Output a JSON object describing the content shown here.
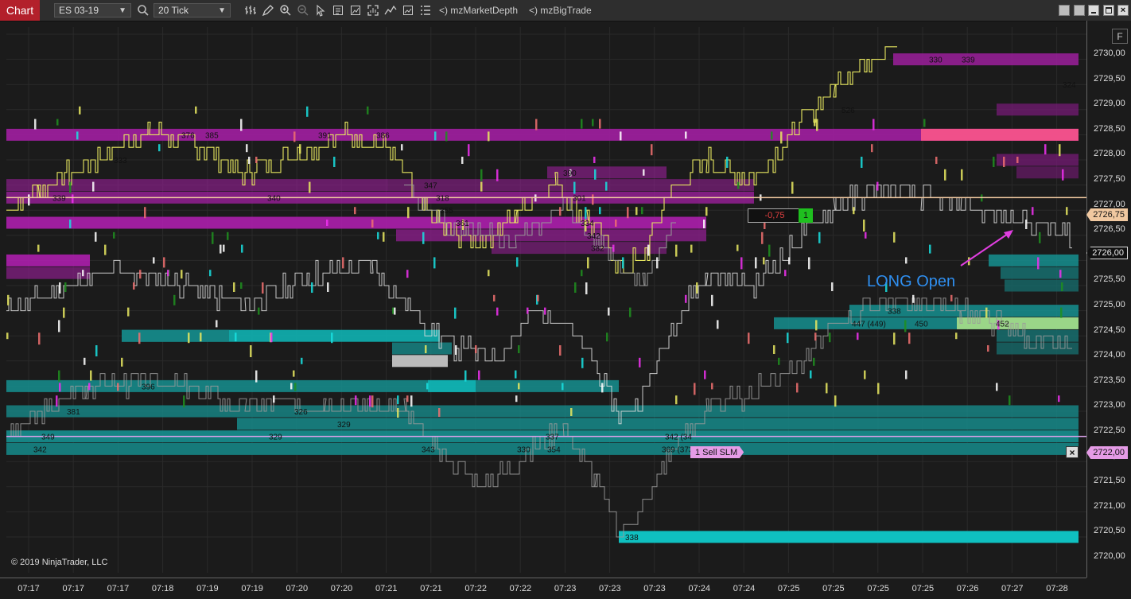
{
  "toolbar": {
    "tab_label": "Chart",
    "instrument": "ES 03-19",
    "bar_type": "20 Tick",
    "indicator1": "<)  mzMarketDepth",
    "indicator2": "<)  mzBigTrade"
  },
  "chart": {
    "f_button": "F",
    "copyright": "© 2019 NinjaTrader, LLC",
    "annotation": "LONG Open",
    "pnl": "-0,75",
    "position_qty": "1",
    "order_label": "1  Sell SLM",
    "cancel_icon": "×",
    "price_current": "2726,75",
    "price_last": "2726,00",
    "price_order": "2722,00",
    "colors": {
      "bid_levels": "#9b1f9b",
      "ask_levels": "#168a8a",
      "price_line": "#e8e860",
      "position_line": "#f0c8a0",
      "order_line": "#d9a0e8",
      "accent_red": "#b3202b"
    },
    "y_ticks": [
      "2730,00",
      "2729,50",
      "2729,00",
      "2728,50",
      "2728,00",
      "2727,50",
      "2727,00",
      "2726,50",
      "2726,00",
      "2725,50",
      "2725,00",
      "2724,50",
      "2724,00",
      "2723,50",
      "2723,00",
      "2722,50",
      "2722,00",
      "2721,50",
      "2721,00",
      "2720,50",
      "2720,00"
    ],
    "x_ticks": [
      "07:17",
      "07:17",
      "07:17",
      "07:18",
      "07:19",
      "07:19",
      "07:20",
      "07:20",
      "07:21",
      "07:21",
      "07:22",
      "07:22",
      "07:23",
      "07:23",
      "07:23",
      "07:24",
      "07:24",
      "07:25",
      "07:25",
      "07:25",
      "07:25",
      "07:26",
      "07:27",
      "07:28"
    ],
    "volume_labels": [
      "339",
      "376",
      "385",
      "391",
      "386",
      "340",
      "347",
      "318",
      "355",
      "361",
      "333",
      "301",
      "390",
      "342",
      "334",
      "382",
      "330",
      "339",
      "324",
      "526",
      "447 (449)",
      "450",
      "338",
      "452",
      "396",
      "381",
      "326",
      "329",
      "349",
      "329",
      "342",
      "343",
      "330",
      "354",
      "337",
      "342 (34",
      "369 (373)",
      "338"
    ]
  }
}
